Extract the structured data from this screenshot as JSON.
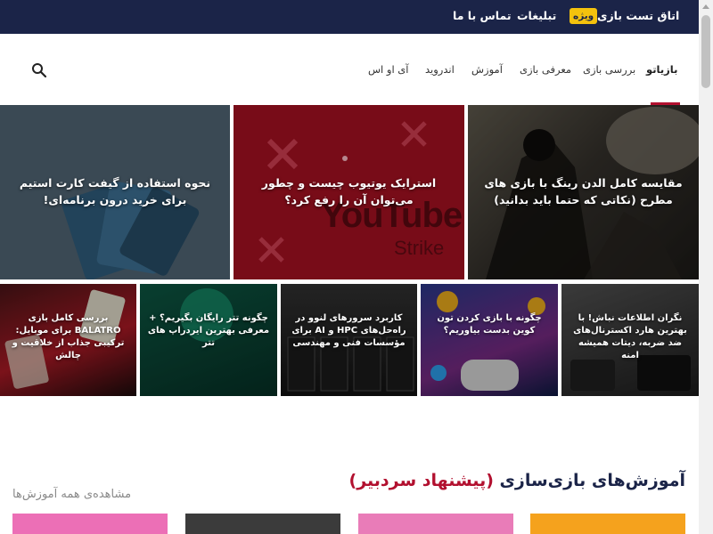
{
  "topbar": {
    "links": [
      {
        "id": "gaming-room",
        "label": "اتاق تست بازی"
      },
      {
        "id": "ads",
        "label": "تبلیغات"
      },
      {
        "id": "contact",
        "label": "تماس با ما"
      }
    ],
    "badge": "ویژه"
  },
  "nav": {
    "items": [
      {
        "id": "bazyato",
        "label": "بازیاتو"
      },
      {
        "id": "review",
        "label": "بررسی بازی"
      },
      {
        "id": "intro",
        "label": "معرفی بازی"
      },
      {
        "id": "tutorial",
        "label": "آموزش"
      },
      {
        "id": "android",
        "label": "اندروید"
      },
      {
        "id": "ios",
        "label": "آی او اس"
      }
    ],
    "icons": {
      "search": "search-icon"
    }
  },
  "featured": [
    {
      "id": "elden-ring",
      "title": "مقایسه کامل الدن رینگ با بازی های مطرح (نکاتی که حتما باید بدانید)"
    },
    {
      "id": "youtube-strike",
      "title": "استرایک یوتیوب چیست و چطور می‌توان آن را رفع کرد؟",
      "overlay_word": "YouTube",
      "overlay_sub": "Strike"
    },
    {
      "id": "steam-gift",
      "title": "نحوه استفاده از گیفت کارت استیم برای خرید درون برنامه‌ای!"
    }
  ],
  "secondary": [
    {
      "id": "nintendo",
      "title": "نگران اطلاعات نباش! با بهترین هارد اکسترنال‌های ضد ضربه، دیتات همیشه امنه"
    },
    {
      "id": "ton",
      "title": "چگونه با بازی کردن تون کوین بدست بیاوریم؟"
    },
    {
      "id": "lenovo",
      "title": "کاربرد سرورهای لنوو در راه‌حل‌های HPC و AI برای مؤسسات فنی و مهندسی"
    },
    {
      "id": "tether",
      "title": "چگونه تتر رایگان بگیریم؟ + معرفی بهترین ایردراپ های تتر"
    },
    {
      "id": "balatro",
      "title": "بررسی کامل بازی BALATRO برای موبایل: ترکیبی جذاب از خلاقیت و چالش"
    }
  ],
  "section": {
    "title_main": "آموزش‌های بازی‌سازی",
    "title_accent": "(پیشنهاد سردبیر)",
    "see_all": "مشاهده‌ی همه آموزش‌ها"
  },
  "colors": {
    "topbar_bg": "#1b2448",
    "accent": "#b2102f",
    "badge": "#f4c20d"
  }
}
